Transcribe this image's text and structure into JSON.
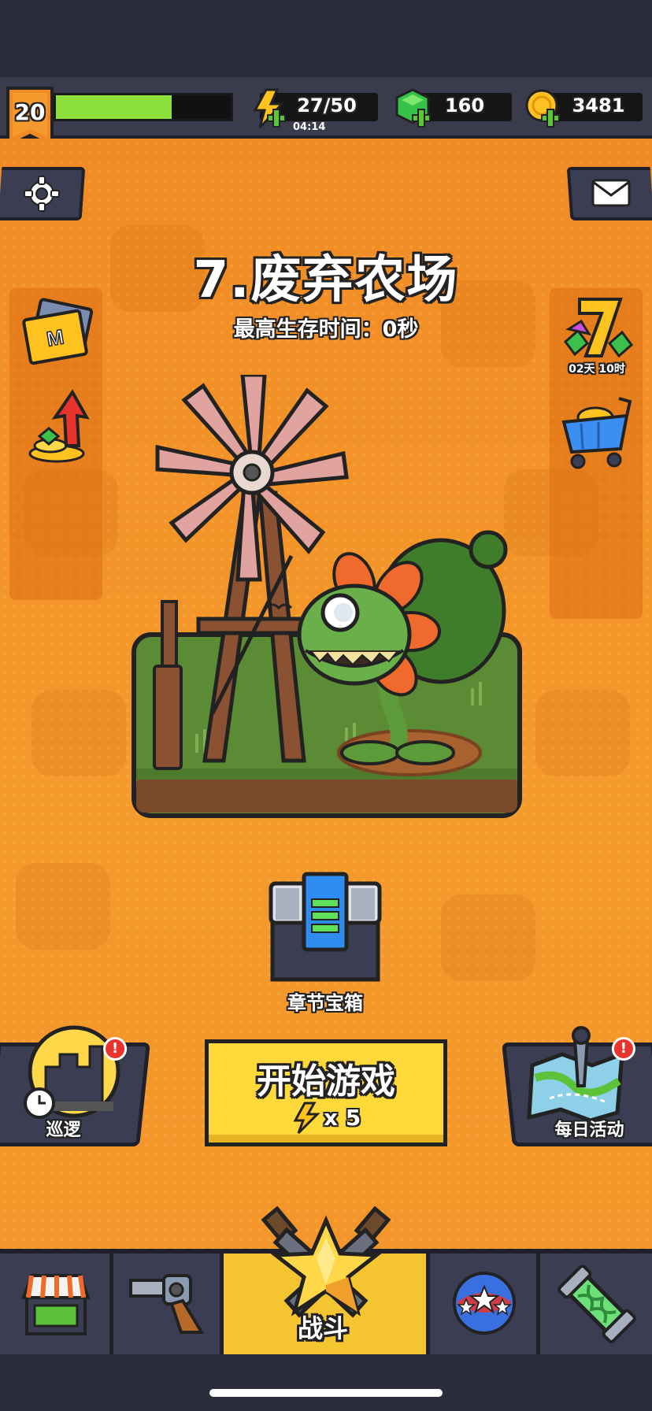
{
  "hud": {
    "level": "20",
    "xp_progress": 0.66,
    "energy": "27/50",
    "energy_timer": "04:14",
    "gems": "160",
    "coins": "3481"
  },
  "stage": {
    "title": "7.废弃农场",
    "best_survival": "最高生存时间：0秒"
  },
  "side_right": {
    "event_timer": "02天 10时"
  },
  "chest": {
    "label": "章节宝箱"
  },
  "actions": {
    "patrol_label": "巡逻",
    "start_label": "开始游戏",
    "start_cost": "x 5",
    "daily_label": "每日活动"
  },
  "nav": {
    "battle_label": "战斗"
  },
  "colors": {
    "orange_bg": "#f3952a",
    "xp_green": "#8ee03c",
    "start_yellow": "#ffd83a",
    "nav_dark": "#3b3e52",
    "active_tab": "#f5c431"
  }
}
